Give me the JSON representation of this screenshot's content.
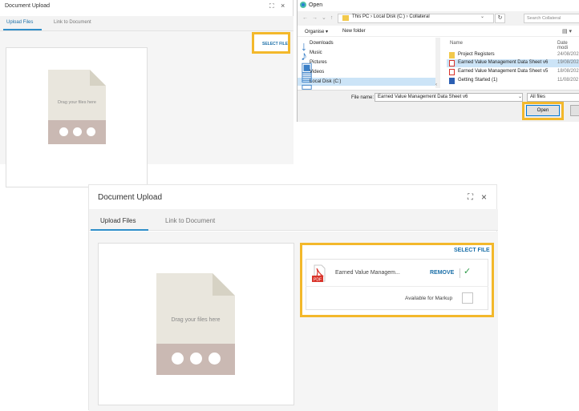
{
  "small_dialog": {
    "title": "Document Upload",
    "maximize_icon": "maximize-icon",
    "close_icon": "close-icon",
    "close_glyph": "×",
    "maximize_glyph": "⛶",
    "tabs": [
      {
        "label": "Upload Files",
        "active": true
      },
      {
        "label": "Link to Document",
        "active": false
      }
    ],
    "drop_text": "Drag your files here",
    "select_file": "SELECT FILE"
  },
  "open_dialog": {
    "title": "Open",
    "path": "This PC  ›  Local Disk (C:)  ›  Collateral",
    "search_placeholder": "Search Collateral",
    "toolbar": {
      "organise": "Organise ▾",
      "new_folder": "New folder"
    },
    "nav_items": [
      {
        "label": "Downloads",
        "icon": "↓"
      },
      {
        "label": "Music",
        "icon": "♪"
      },
      {
        "label": "Pictures",
        "icon": "▣"
      },
      {
        "label": "Videos",
        "icon": "▤"
      },
      {
        "label": "Local Disk (C:)",
        "icon": "▭"
      }
    ],
    "columns": {
      "name": "Name",
      "date": "Date modi"
    },
    "files": [
      {
        "name": "Project Registers",
        "date": "24/08/202",
        "type": "folder",
        "selected": false
      },
      {
        "name": "Earned Value Management Data Sheet v6",
        "date": "19/08/202",
        "type": "pdf",
        "selected": true
      },
      {
        "name": "Earned Value Management Data Sheet v5",
        "date": "18/08/202",
        "type": "pdf",
        "selected": false
      },
      {
        "name": "Getting Started (1)",
        "date": "11/08/202",
        "type": "doc",
        "selected": false
      }
    ],
    "filename_label": "File name:",
    "filename_value": "Earned Value Management Data Sheet v6",
    "filetype": "All files",
    "open_label": "Open"
  },
  "large_dialog": {
    "title": "Document Upload",
    "tabs": [
      {
        "label": "Upload Files",
        "active": true
      },
      {
        "label": "Link to Document",
        "active": false
      }
    ],
    "drop_text": "Drag your files here",
    "select_file": "SELECT FILE",
    "file": {
      "name": "Earned Value Managem...",
      "icon_label": "PDF"
    },
    "remove": "REMOVE",
    "markup_label": "Available for Markup"
  },
  "colors": {
    "highlight": "#f3b82b",
    "accent": "#1b6fa8",
    "check": "#2e9a48",
    "pdf": "#d9342b"
  }
}
